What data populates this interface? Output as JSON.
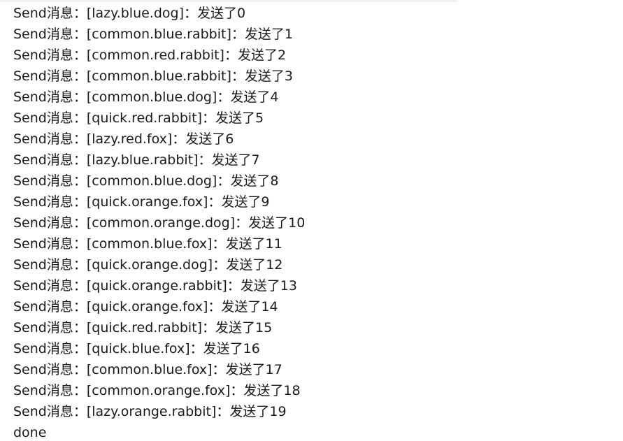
{
  "console": {
    "lines": [
      "Send消息：[lazy.blue.dog]：发送了0",
      "Send消息：[common.blue.rabbit]：发送了1",
      "Send消息：[common.red.rabbit]：发送了2",
      "Send消息：[common.blue.rabbit]：发送了3",
      "Send消息：[common.blue.dog]：发送了4",
      "Send消息：[quick.red.rabbit]：发送了5",
      "Send消息：[lazy.red.fox]：发送了6",
      "Send消息：[lazy.blue.rabbit]：发送了7",
      "Send消息：[common.blue.dog]：发送了8",
      "Send消息：[quick.orange.fox]：发送了9",
      "Send消息：[common.orange.dog]：发送了10",
      "Send消息：[common.blue.fox]：发送了11",
      "Send消息：[quick.orange.dog]：发送了12",
      "Send消息：[quick.orange.rabbit]：发送了13",
      "Send消息：[quick.orange.fox]：发送了14",
      "Send消息：[quick.red.rabbit]：发送了15",
      "Send消息：[quick.blue.fox]：发送了16",
      "Send消息：[common.blue.fox]：发送了17",
      "Send消息：[common.orange.fox]：发送了18",
      "Send消息：[lazy.orange.rabbit]：发送了19",
      "done"
    ]
  },
  "colors": {
    "text": "#1a1a1a",
    "background": "#ffffff",
    "top_rule": "#eef3ec"
  }
}
